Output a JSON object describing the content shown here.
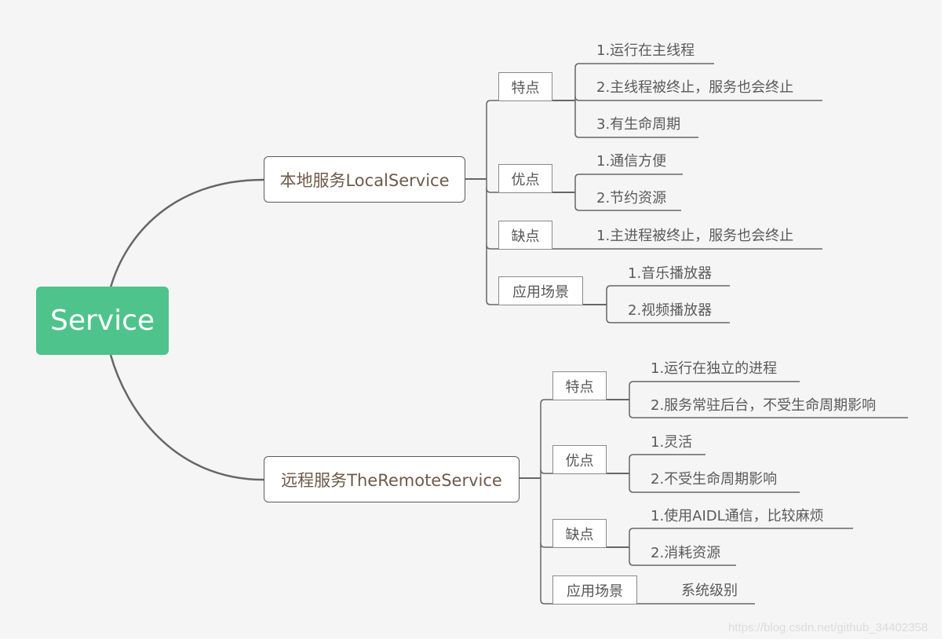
{
  "root": {
    "label": "Service",
    "color": "#4fc38c"
  },
  "branches": [
    {
      "label": "本地服务LocalService",
      "categories": [
        {
          "label": "特点",
          "items": [
            "1.运行在主线程",
            "2.主线程被终止，服务也会终止",
            "3.有生命周期"
          ]
        },
        {
          "label": "优点",
          "items": [
            "1.通信方便",
            "2.节约资源"
          ]
        },
        {
          "label": "缺点",
          "items": [
            "1.主进程被终止，服务也会终止"
          ]
        },
        {
          "label": "应用场景",
          "items": [
            "1.音乐播放器",
            "2.视频播放器"
          ]
        }
      ]
    },
    {
      "label": "远程服务TheRemoteService",
      "categories": [
        {
          "label": "特点",
          "items": [
            "1.运行在独立的进程",
            "2.服务常驻后台，不受生命周期影响"
          ]
        },
        {
          "label": "优点",
          "items": [
            "1.灵活",
            "2.不受生命周期影响"
          ]
        },
        {
          "label": "缺点",
          "items": [
            "1.使用AIDL通信，比较麻烦",
            "2.消耗资源"
          ]
        },
        {
          "label": "应用场景",
          "items": [
            "系统级别"
          ]
        }
      ]
    }
  ],
  "watermark": "https://blog.csdn.net/github_34402358",
  "colors": {
    "line": "#666666",
    "branch_text": "#6e5a48",
    "leaf_text": "#5a5a5a",
    "canvas": "#f5f5f5"
  }
}
